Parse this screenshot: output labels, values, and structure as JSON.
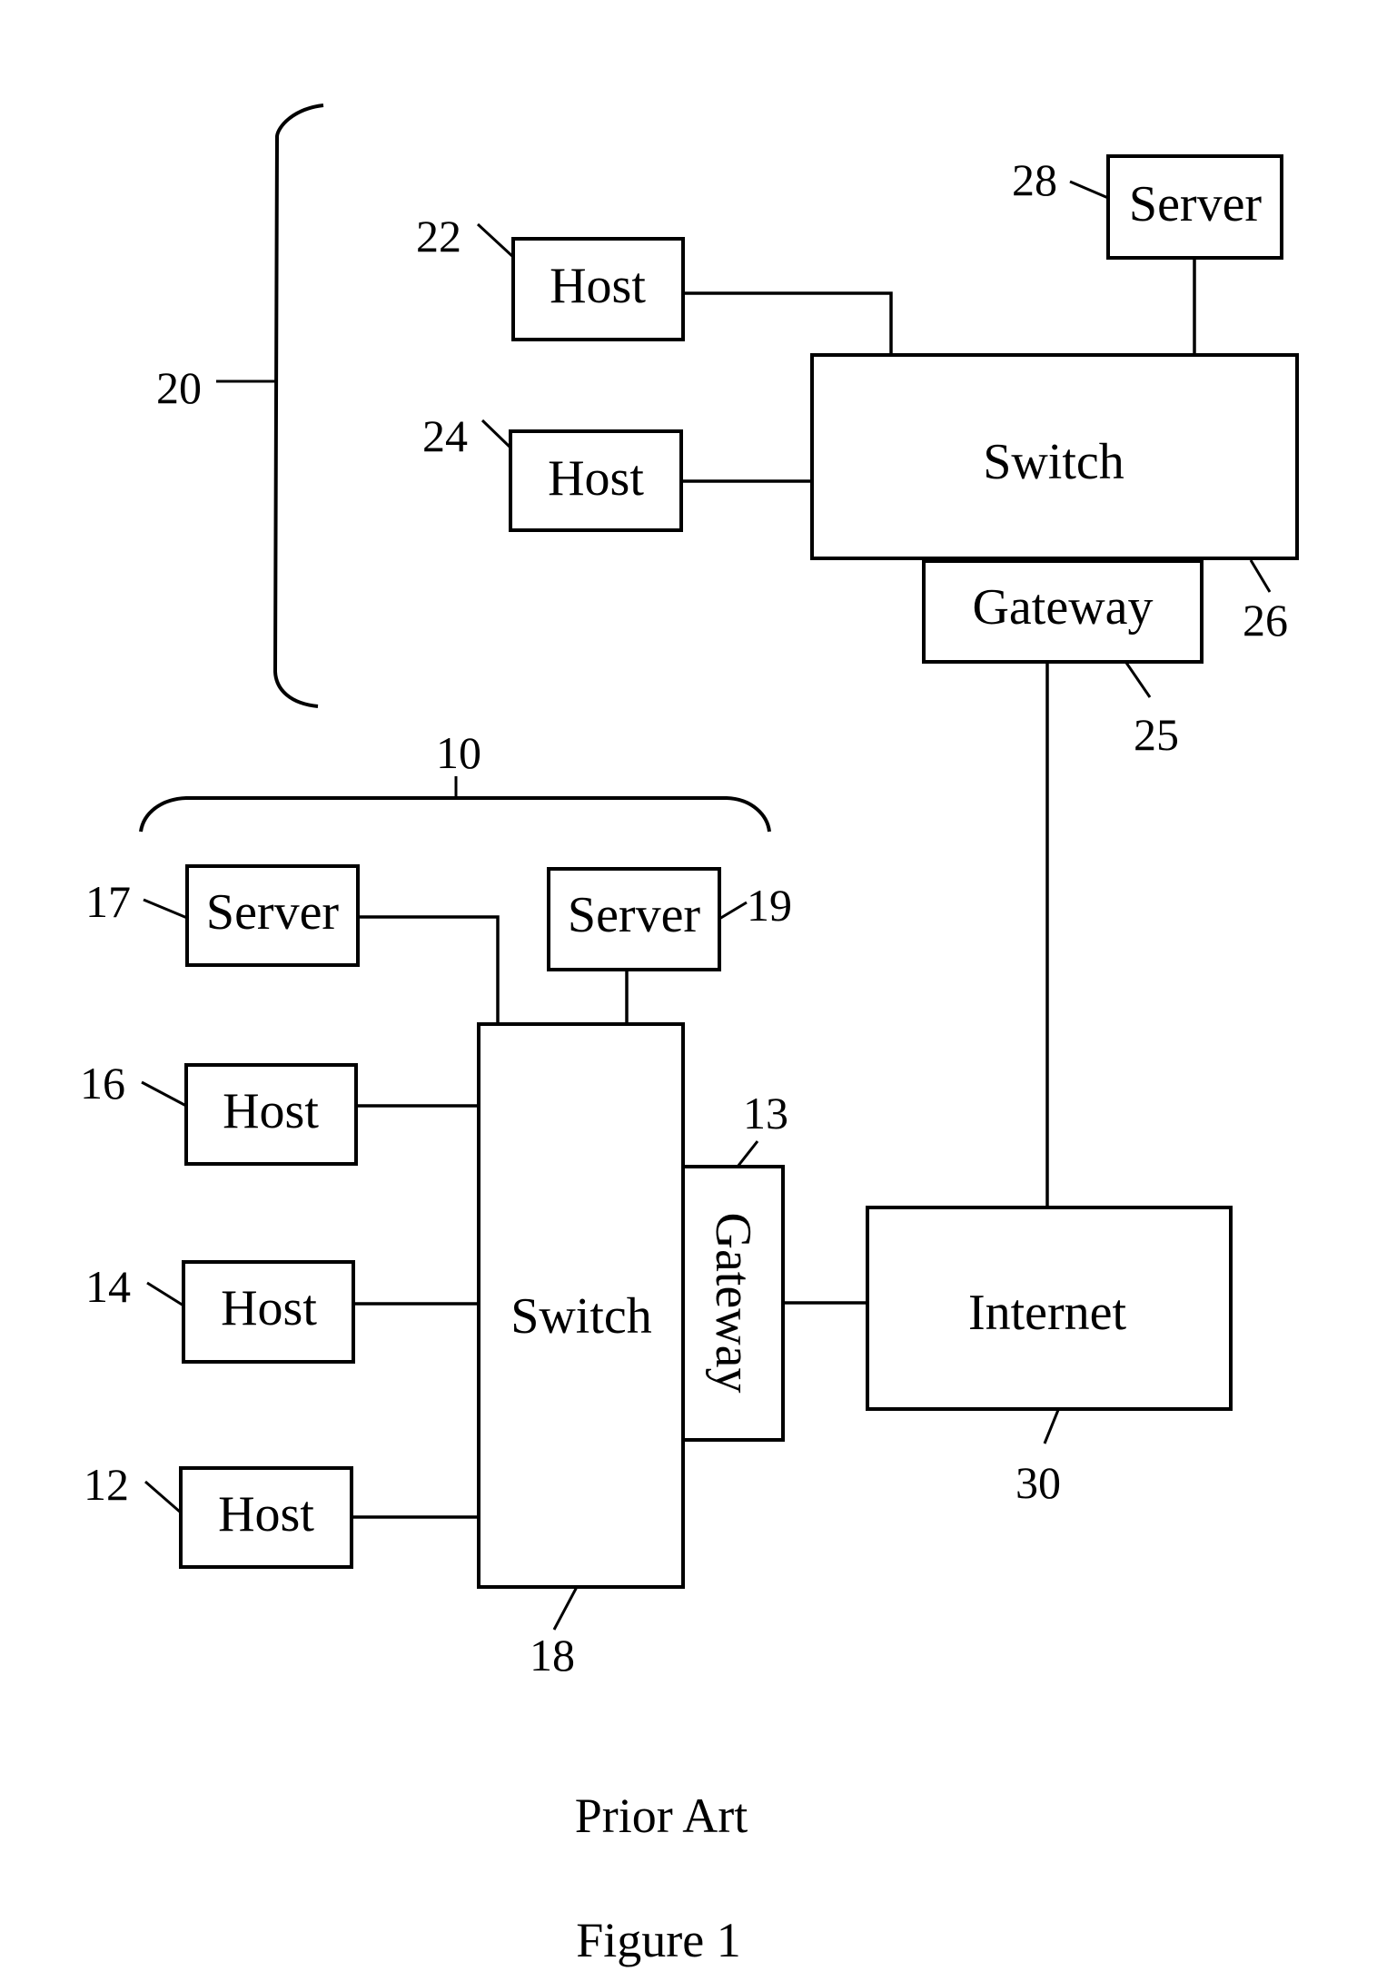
{
  "figure": {
    "caption_line1": "Prior Art",
    "caption_line2": "Figure 1"
  },
  "network_20": {
    "ref": "20",
    "host_22": {
      "ref": "22",
      "label": "Host"
    },
    "host_24": {
      "ref": "24",
      "label": "Host"
    },
    "server_28": {
      "ref": "28",
      "label": "Server"
    },
    "switch_26": {
      "ref": "26",
      "label": "Switch"
    },
    "gateway_25": {
      "ref": "25",
      "label": "Gateway"
    }
  },
  "network_10": {
    "ref": "10",
    "server_17": {
      "ref": "17",
      "label": "Server"
    },
    "server_19": {
      "ref": "19",
      "label": "Server"
    },
    "host_16": {
      "ref": "16",
      "label": "Host"
    },
    "host_14": {
      "ref": "14",
      "label": "Host"
    },
    "host_12": {
      "ref": "12",
      "label": "Host"
    },
    "switch_18": {
      "ref": "18",
      "label": "Switch"
    },
    "gateway_13": {
      "ref": "13",
      "label": "Gateway"
    }
  },
  "internet": {
    "ref": "30",
    "label": "Internet"
  }
}
